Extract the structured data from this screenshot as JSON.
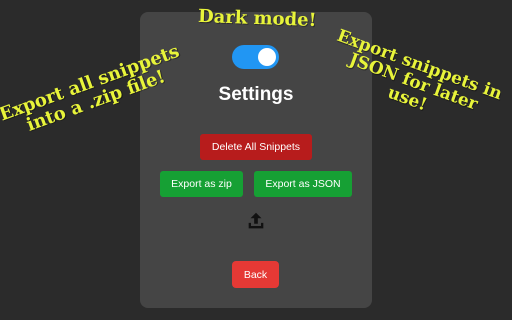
{
  "annotations": {
    "dark_mode": "Dark mode!",
    "zip_line1": "Export all snippets",
    "zip_line2": "into a .zip file!",
    "json_line1": "Export snippets in",
    "json_line2": "JSON for later",
    "json_line3": "use!"
  },
  "settings": {
    "title": "Settings",
    "dark_mode_enabled": true,
    "delete_label": "Delete All Snippets",
    "export_zip_label": "Export as zip",
    "export_json_label": "Export as JSON",
    "import_icon": "upload-icon",
    "back_label": "Back"
  },
  "colors": {
    "toggle_on": "#2196f3",
    "delete": "#b71c1c",
    "export": "#16a034",
    "back": "#e53935",
    "annotation": "#e8f43a"
  }
}
